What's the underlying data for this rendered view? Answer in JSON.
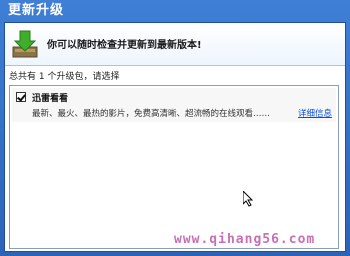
{
  "window": {
    "title": "更新升级"
  },
  "banner": {
    "text": "你可以随时检查并更新到最新版本!",
    "icon": "download-arrow-icon"
  },
  "summary": {
    "text": "总共有 1 个升级包，请选择"
  },
  "updates": [
    {
      "checked": true,
      "name": "迅雷看看",
      "description": "最新、最火、最热的影片，免费高清晰、超流畅的在线观看……",
      "details_link": "详细信息"
    }
  ],
  "watermark": "www.qihang56.com",
  "colors": {
    "title_bar": "#2b63b8",
    "link": "#0b4fd8",
    "watermark": "#c96fb6"
  }
}
